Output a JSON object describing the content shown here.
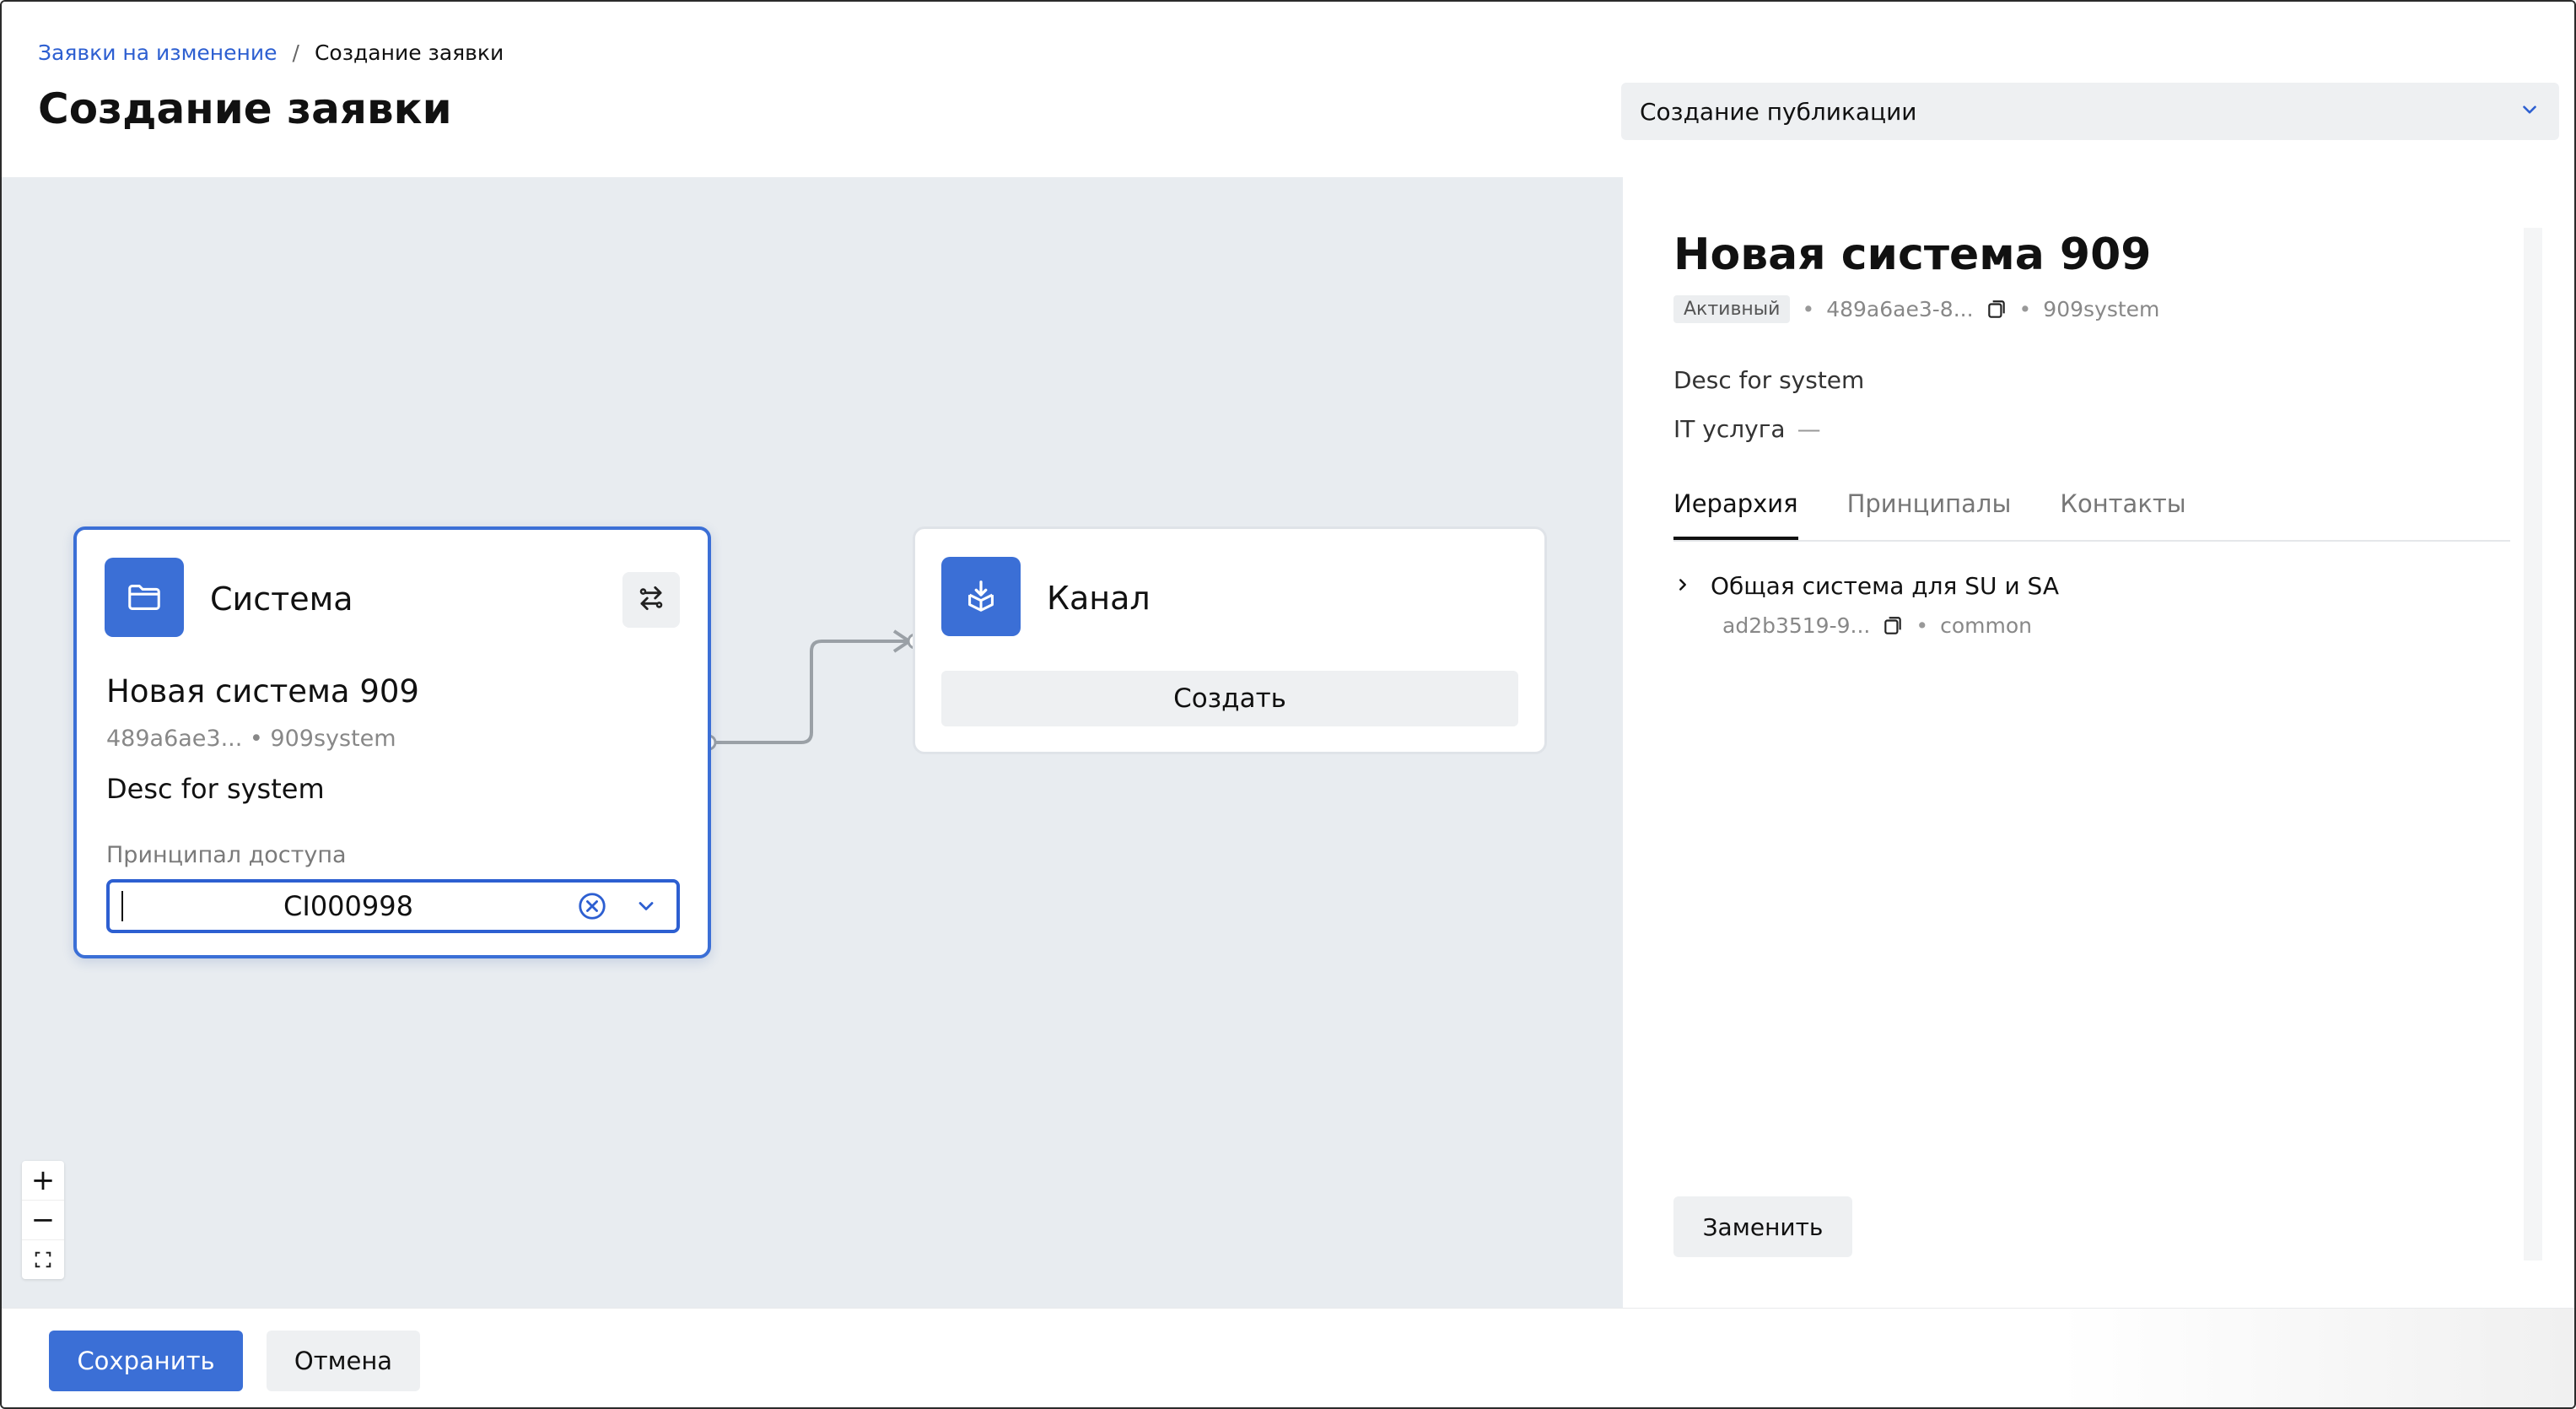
{
  "breadcrumb": {
    "parent": "Заявки на изменение",
    "separator": "/",
    "current": "Создание заявки"
  },
  "page_title": "Создание заявки",
  "request_type": {
    "selected": "Создание публикации"
  },
  "canvas": {
    "system_node": {
      "type_label": "Система",
      "name": "Новая система 909",
      "meta": "489a6ae3... • 909system",
      "description": "Desc for system",
      "principal_label": "Принципал доступа",
      "principal_value": "CI000998"
    },
    "channel_node": {
      "type_label": "Канал",
      "create_label": "Создать"
    },
    "zoom": {
      "zoom_in": "+",
      "zoom_out": "−",
      "fit": "⛶"
    }
  },
  "panel": {
    "title": "Новая система 909",
    "status": "Активный",
    "id_short": "489a6ae3-8...",
    "code": "909system",
    "description": "Desc for system",
    "it_service_label": "IT услуга",
    "it_service_value": "—",
    "tabs": [
      {
        "label": "Иерархия"
      },
      {
        "label": "Принципалы"
      },
      {
        "label": "Контакты"
      }
    ],
    "hierarchy": [
      {
        "name": "Общая система для SU и SA",
        "id_short": "ad2b3519-9...",
        "code": "common"
      }
    ],
    "replace_label": "Заменить"
  },
  "footer": {
    "save_label": "Сохранить",
    "cancel_label": "Отмена"
  },
  "colors": {
    "accent": "#3b6fd6",
    "link": "#2d5fd1",
    "canvas_bg": "#e8ecf0"
  }
}
